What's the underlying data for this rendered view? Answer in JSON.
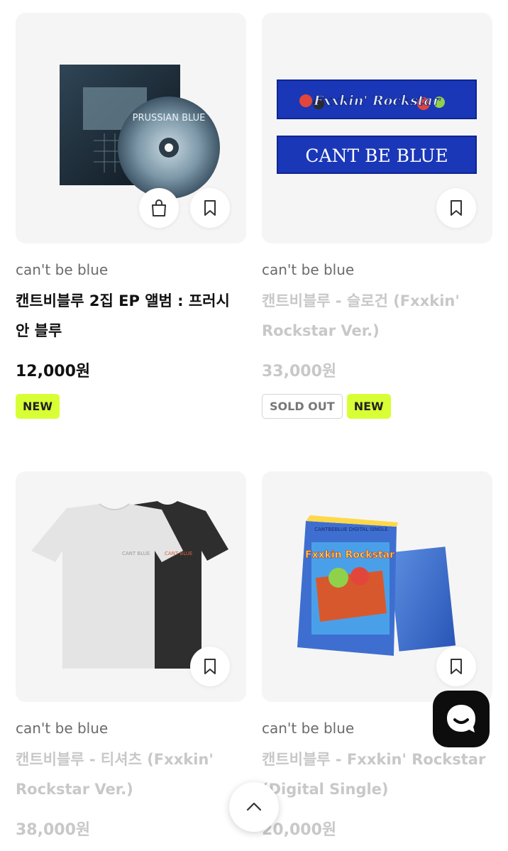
{
  "products": [
    {
      "brand": "can't be blue",
      "title": "캔트비블루 2집 EP 앨범 : 프러시안 블루",
      "price": "12,000원",
      "badges": [
        "NEW"
      ],
      "sold_out": false,
      "image": "album-cd-image",
      "image_text": "PRUSSIAN BLUE"
    },
    {
      "brand": "can't be blue",
      "title": "캔트비블루 - 슬로건 (Fxxkin' Rockstar Ver.)",
      "price": "33,000원",
      "badges": [
        "SOLD OUT",
        "NEW"
      ],
      "sold_out": true,
      "image": "slogan-banner-image",
      "image_text_top": "Fxxkin' Rockstar",
      "image_text_bottom": "CANT BE BLUE"
    },
    {
      "brand": "can't be blue",
      "title": "캔트비블루 - 티셔츠 (Fxxkin' Rockstar Ver.)",
      "price": "38,000원",
      "badges": [],
      "sold_out": true,
      "image": "tshirt-image"
    },
    {
      "brand": "can't be blue",
      "title": "캔트비블루 - Fxxkin' Rockstar (Digital Single)",
      "price": "20,000원",
      "badges": [],
      "sold_out": true,
      "image": "digital-single-box-image",
      "image_text": "CANTBEBLUE DIGITAL SINGLE"
    }
  ],
  "icons": {
    "cart": "shopping-bag-icon",
    "bookmark": "bookmark-icon",
    "chat": "chat-bubble-icon",
    "scroll_top": "chevron-up-icon"
  },
  "colors": {
    "new_badge": "#d8ff35",
    "muted_text": "#c8c8c8",
    "thumb_bg": "#f5f5f5"
  }
}
